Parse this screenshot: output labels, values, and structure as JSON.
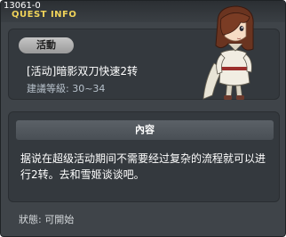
{
  "window": {
    "quest_id": "13061-0",
    "title": "QUEST INFO"
  },
  "quest": {
    "category_badge": "活動",
    "name": "[活动]暗影双刀快速2转",
    "level_label": "建議等級:",
    "level_range": "30~34"
  },
  "content": {
    "header": "內容",
    "description": "据说在超级活动期间不需要经过复杂的流程就可以进行2转。去和雪姬谈谈吧。"
  },
  "status": {
    "label": "狀態:",
    "value": "可開始"
  },
  "icons": {
    "close": "close-icon",
    "npc": "npc-character-portrait"
  },
  "colors": {
    "title_accent": "#f0d35a",
    "panel_bg": "#34393e",
    "window_bg": "#3f4449"
  }
}
